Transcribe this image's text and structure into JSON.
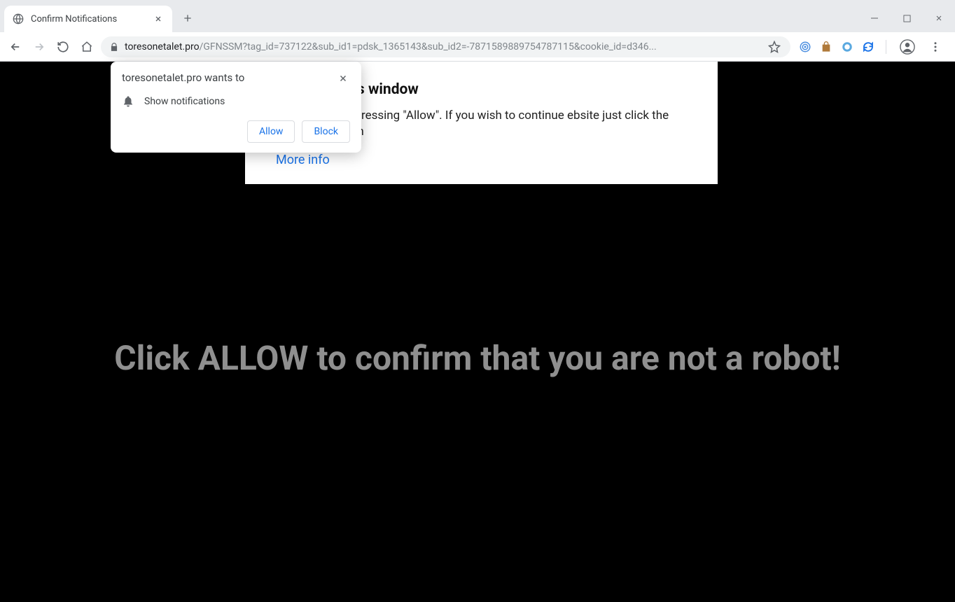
{
  "tab": {
    "title": "Confirm Notifications"
  },
  "url": {
    "domain": "toresonetalet.pro",
    "path": "/GFNSSM?tag_id=737122&sub_id1=pdsk_1365143&sub_id2=-7871589889754787115&cookie_id=d346..."
  },
  "page": {
    "popup_heading_suffix": "\" to close this window",
    "popup_body": "n be closed by pressing \"Allow\". If you wish to continue ebsite just click the more info button",
    "more_info_label": "More info",
    "big_message": "Click ALLOW to confirm that you are not a robot!"
  },
  "permission_prompt": {
    "origin_message": "toresonetalet.pro wants to",
    "request_label": "Show notifications",
    "allow_label": "Allow",
    "block_label": "Block"
  }
}
